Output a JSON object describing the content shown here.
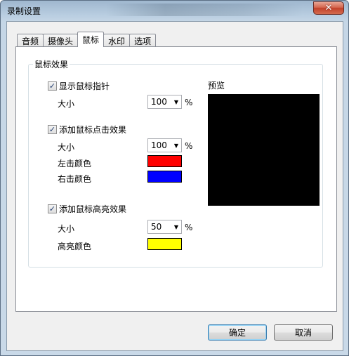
{
  "window": {
    "title": "录制设置",
    "close_glyph": "✕"
  },
  "tabs": [
    {
      "label": "音频"
    },
    {
      "label": "摄像头"
    },
    {
      "label": "鼠标"
    },
    {
      "label": "水印"
    },
    {
      "label": "选项"
    }
  ],
  "active_tab": "鼠标",
  "mouse_effects": {
    "group_title": "鼠标效果",
    "show_pointer": {
      "label": "显示鼠标指针",
      "checked": true,
      "size_label": "大小",
      "size_value": "100",
      "unit": "%"
    },
    "click_effect": {
      "label": "添加鼠标点击效果",
      "checked": true,
      "size_label": "大小",
      "size_value": "100",
      "unit": "%",
      "left_click_label": "左击颜色",
      "left_click_color": "#ff0000",
      "right_click_label": "右击颜色",
      "right_click_color": "#0000ff"
    },
    "highlight_effect": {
      "label": "添加鼠标高亮效果",
      "checked": true,
      "size_label": "大小",
      "size_value": "50",
      "unit": "%",
      "highlight_color_label": "高亮颜色",
      "highlight_color": "#ffff00"
    },
    "preview_label": "预览"
  },
  "buttons": {
    "ok": "确定",
    "cancel": "取消"
  },
  "check_glyph": "✓",
  "dropdown_glyph": "▼"
}
